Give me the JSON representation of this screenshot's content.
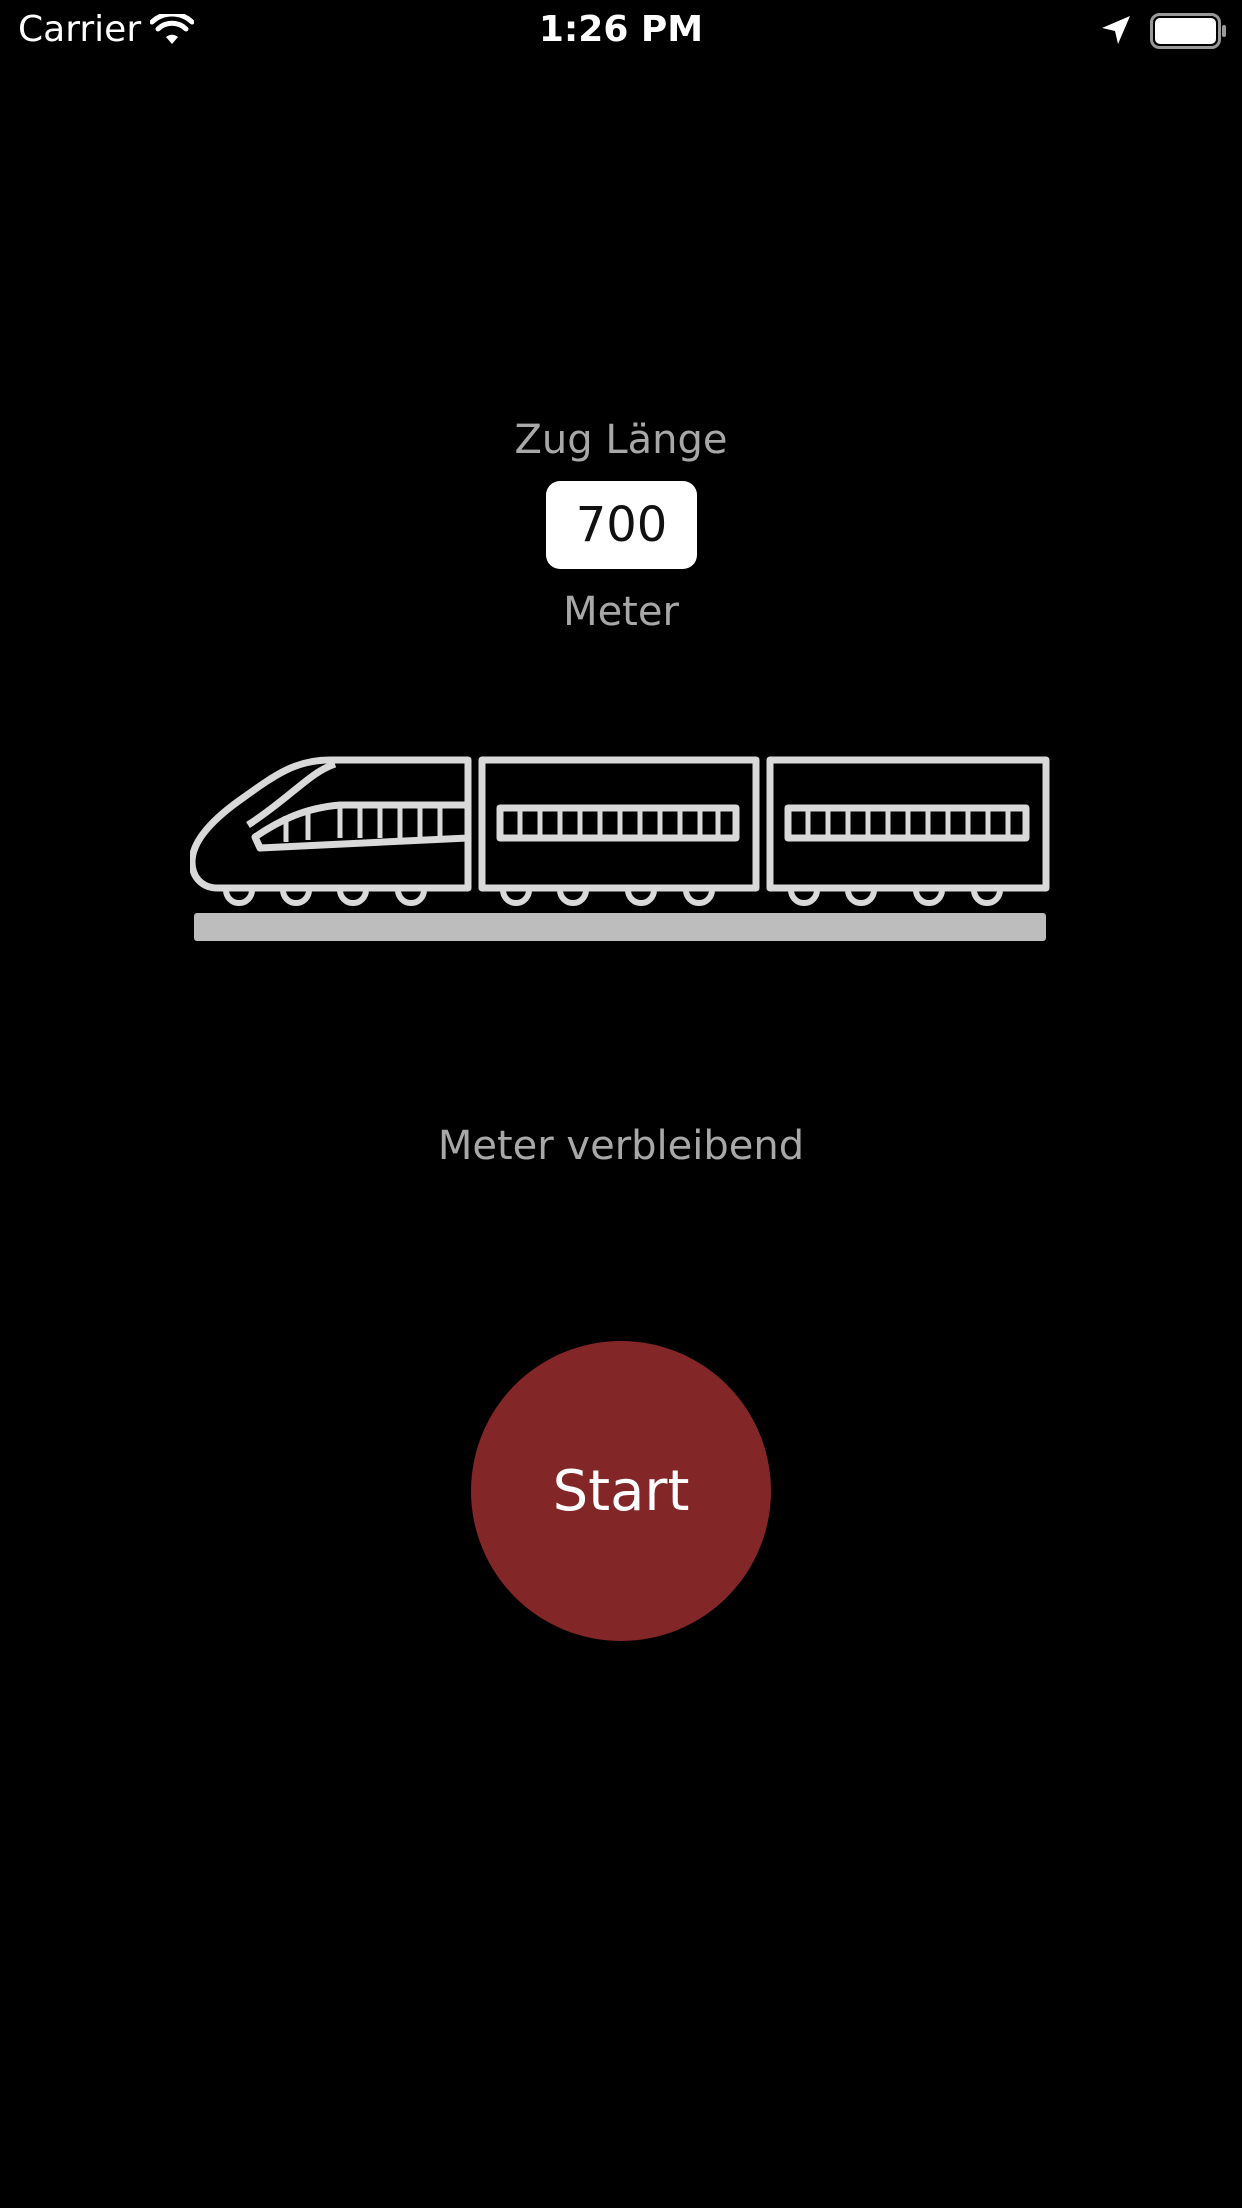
{
  "status_bar": {
    "carrier": "Carrier",
    "time": "1:26 PM",
    "icons": [
      "wifi-icon",
      "location-icon",
      "battery-icon"
    ]
  },
  "train_length": {
    "label": "Zug Länge",
    "value": "700",
    "unit": "Meter"
  },
  "illustration": {
    "icon": "train-icon",
    "cars": 3
  },
  "remaining": {
    "label": "Meter verbleibend"
  },
  "start_button": {
    "label": "Start"
  },
  "colors": {
    "background": "#000000",
    "label_text": "#a8a8a8",
    "train_stroke": "#d9d9d9",
    "track": "#bdbdbd",
    "start_button": "#832628"
  }
}
